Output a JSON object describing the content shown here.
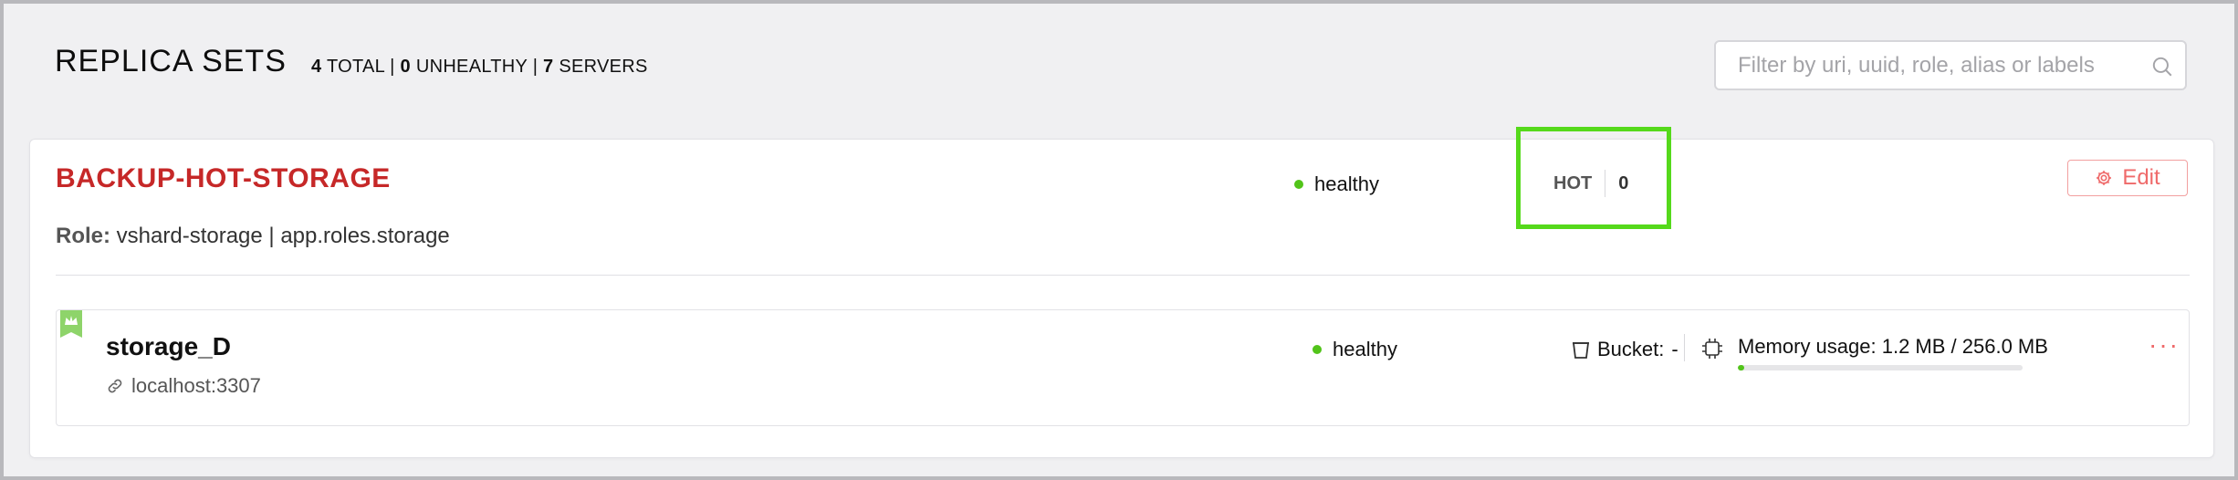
{
  "header": {
    "title": "REPLICA SETS",
    "summary": {
      "total_count": "4",
      "total_label": "TOTAL",
      "unhealthy_count": "0",
      "unhealthy_label": "UNHEALTHY",
      "servers_count": "7",
      "servers_label": "SERVERS",
      "separator": "|"
    },
    "search": {
      "placeholder": "Filter by uri, uuid, role, alias or labels",
      "value": "",
      "icon": "search-icon"
    }
  },
  "replicaset": {
    "name": "BACKUP-HOT-STORAGE",
    "status": "healthy",
    "status_color": "#52c41a",
    "role_label": "Role:",
    "roles": "vshard-storage | app.roles.storage",
    "group_label": "HOT",
    "group_weight": "0",
    "edit_label": "Edit",
    "edit_icon": "gear-icon",
    "servers": [
      {
        "alias": "storage_D",
        "uri": "localhost:3307",
        "leader_icon": "crown-icon",
        "status": "healthy",
        "bucket_label": "Bucket:",
        "bucket_value": "-",
        "memory_label": "Memory usage: 1.2 MB / 256.0 MB",
        "memory_fraction": 0.005,
        "more_label": "···"
      }
    ]
  },
  "colors": {
    "accent": "#c62828",
    "edit": "#ef6a6a",
    "healthy": "#52c41a",
    "highlight": "#55d91b"
  }
}
